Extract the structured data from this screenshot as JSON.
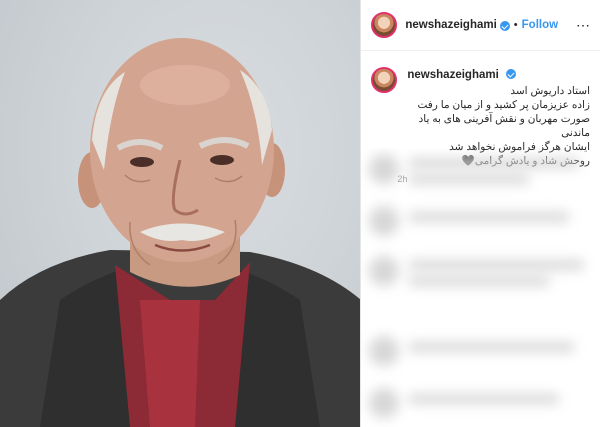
{
  "post": {
    "username": "newshazeighami",
    "follow_label": "Follow",
    "separator": "•",
    "more_label": "⋯",
    "caption_lines": [
      "استاد داریوش اسد",
      "زاده عزیزمان پر کشید و از میان ما رفت",
      "صورت مهربان و نقش آفرینی های به یاد ماندنی",
      "ایشان هرگز فراموش نخواهد شد",
      "روحش شاد و یادش گرامی🖤"
    ],
    "time": "2h"
  },
  "colors": {
    "accent": "#3897f0",
    "story_ring": "#e1306c",
    "text": "#262626"
  },
  "icons": {
    "verified": "verified-badge-icon",
    "more": "more-options-icon"
  }
}
